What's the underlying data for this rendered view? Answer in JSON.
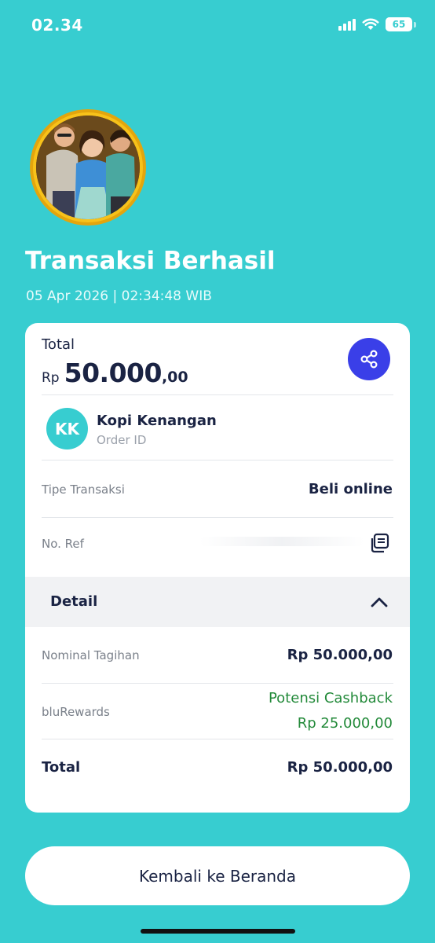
{
  "status_bar": {
    "time": "02.34",
    "battery": "65",
    "battery_level": 0.65
  },
  "header": {
    "title": "Transaksi Berhasil",
    "datetime": "05 Apr 2026 | 02:34:48 WIB"
  },
  "summary": {
    "total_label": "Total",
    "currency": "Rp",
    "amount_main": "50.000",
    "amount_decimal": ",00"
  },
  "merchant": {
    "initials": "KK",
    "name": "Kopi Kenangan",
    "subtitle": "Order ID"
  },
  "info_rows": {
    "transaction_type_label": "Tipe Transaksi",
    "transaction_type_value": "Beli online",
    "ref_label": "No. Ref"
  },
  "detail": {
    "title": "Detail",
    "nominal_label": "Nominal Tagihan",
    "nominal_value": "Rp 50.000,00",
    "rewards_label": "bluRewards",
    "rewards_line1": "Potensi Cashback",
    "rewards_line2": "Rp 25.000,00",
    "total_label": "Total",
    "total_value": "Rp 50.000,00"
  },
  "actions": {
    "home_button": "Kembali ke Beranda"
  },
  "colors": {
    "background": "#37cdd0",
    "share_button": "#3a3fe8",
    "cashback_green": "#238a3a",
    "text_dark": "#1a2343"
  },
  "icons": {
    "share": "share-icon",
    "copy": "copy-icon",
    "chevron": "chevron-up-icon",
    "wifi": "wifi-icon",
    "signal": "signal-icon",
    "battery": "battery-icon"
  }
}
